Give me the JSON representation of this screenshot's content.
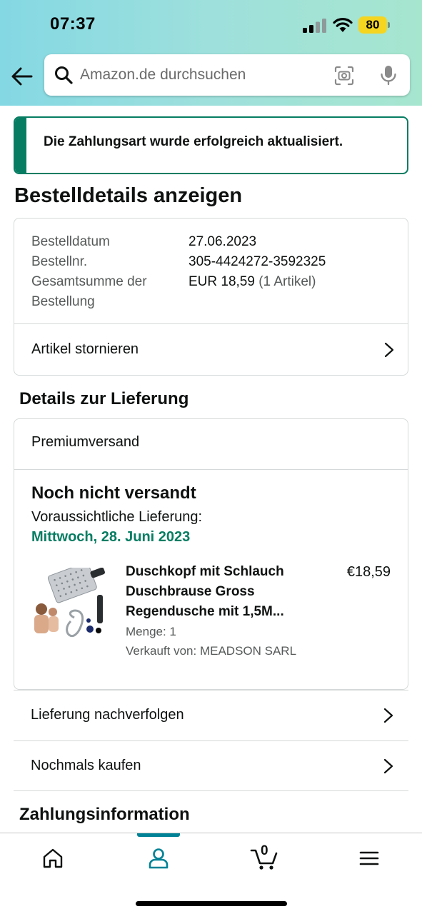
{
  "status_bar": {
    "time": "07:37",
    "battery": "80",
    "colors": {
      "battery": "#f5d51f"
    }
  },
  "search": {
    "placeholder": "Amazon.de durchsuchen"
  },
  "alert": {
    "message": "Die Zahlungsart wurde erfolgreich aktualisiert.",
    "color": "#067d62"
  },
  "page": {
    "title": "Bestelldetails anzeigen"
  },
  "order": {
    "date_label": "Bestelldatum",
    "date_value": "27.06.2023",
    "number_label": "Bestellnr.",
    "number_value": "305-4424272-3592325",
    "total_label_line1": "Gesamtsumme der",
    "total_label_line2": "Bestellung",
    "total_value": "EUR 18,59",
    "total_items": "(1 Artikel)",
    "cancel_link": "Artikel stornieren"
  },
  "delivery": {
    "section_title": "Details zur Lieferung",
    "shipping_method": "Premiumversand",
    "status": "Noch nicht versandt",
    "expected_label": "Voraussichtliche Lieferung:",
    "expected_date": "Mittwoch, 28. Juni 2023",
    "expected_date_color": "#067d62",
    "product": {
      "title_line1": "Duschkopf mit Schlauch",
      "title_line2": "Duschbrause Gross",
      "title_line3": "Regendusche mit 1,5M...",
      "price": "€18,59",
      "quantity": "Menge: 1",
      "seller": "Verkauft von: MEADSON SARL"
    }
  },
  "links": {
    "track": "Lieferung nachverfolgen",
    "buy_again": "Nochmals kaufen"
  },
  "payment": {
    "section_title": "Zahlungsinformation"
  },
  "tabbar": {
    "active": "account",
    "cart_count": "0",
    "accent_color": "#008296",
    "icons": [
      "home-icon",
      "account-icon",
      "cart-icon",
      "menu-icon"
    ]
  }
}
